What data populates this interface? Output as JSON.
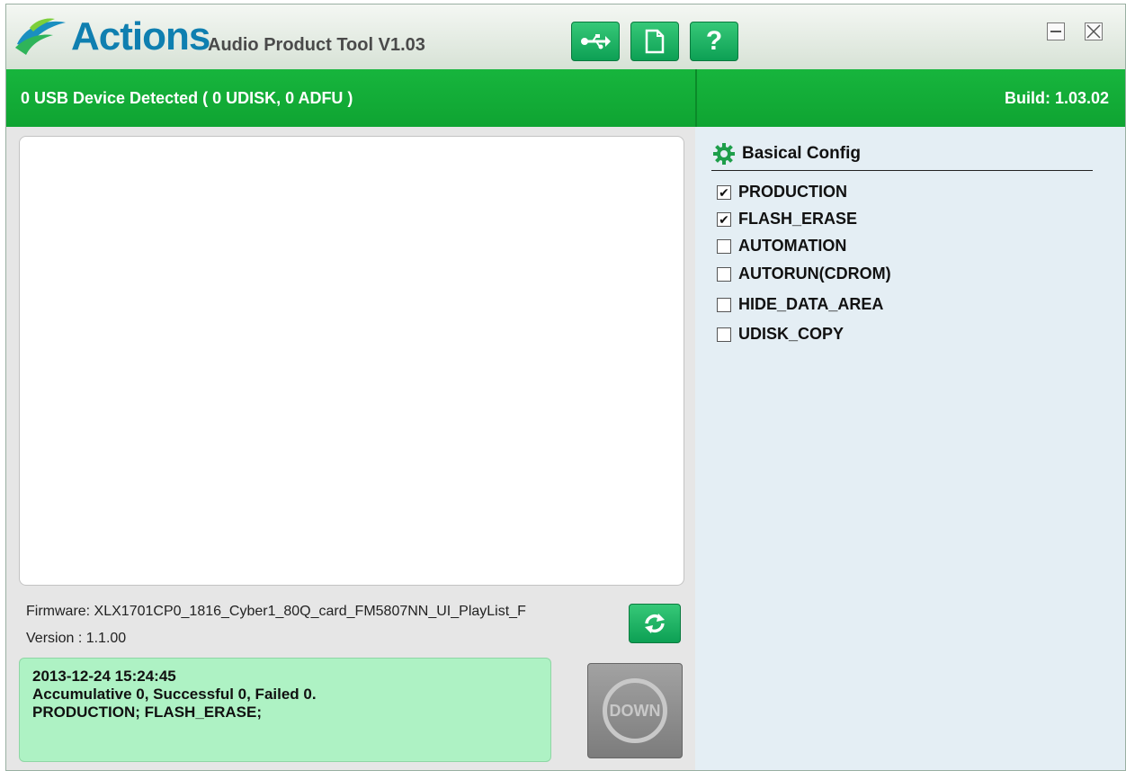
{
  "header": {
    "brand": "Actions",
    "app_title": "Audio Product Tool V1.03",
    "toolbar": [
      {
        "name": "usb-button",
        "icon": "usb-icon"
      },
      {
        "name": "file-button",
        "icon": "file-icon"
      },
      {
        "name": "help-button",
        "icon": "help-icon",
        "label": "?"
      }
    ]
  },
  "status": {
    "usb_detected": "0 USB Device Detected ( 0 UDISK, 0 ADFU )",
    "build": "Build: 1.03.02"
  },
  "firmware": {
    "name": "Firmware: XLX1701CP0_1816_Cyber1_80Q_card_FM5807NN_UI_PlayList_F",
    "version": "Version : 1.1.00"
  },
  "summary": {
    "line1": "2013-12-24 15:24:45",
    "line2": "Accumulative 0, Successful 0, Failed 0.",
    "line3": "PRODUCTION; FLASH_ERASE;"
  },
  "down_button": {
    "label": "DOWN"
  },
  "config": {
    "title": "Basical Config",
    "options": [
      {
        "label": "PRODUCTION",
        "checked": true
      },
      {
        "label": "FLASH_ERASE",
        "checked": true
      },
      {
        "label": "AUTOMATION",
        "checked": false
      },
      {
        "label": "AUTORUN(CDROM)",
        "checked": false
      },
      {
        "label": "HIDE_DATA_AREA",
        "checked": false
      },
      {
        "label": "UDISK_COPY",
        "checked": false
      }
    ]
  },
  "colors": {
    "accent_green": "#0fa432",
    "summary_bg": "#aef2c4",
    "brand_blue": "#0f7fb0"
  }
}
